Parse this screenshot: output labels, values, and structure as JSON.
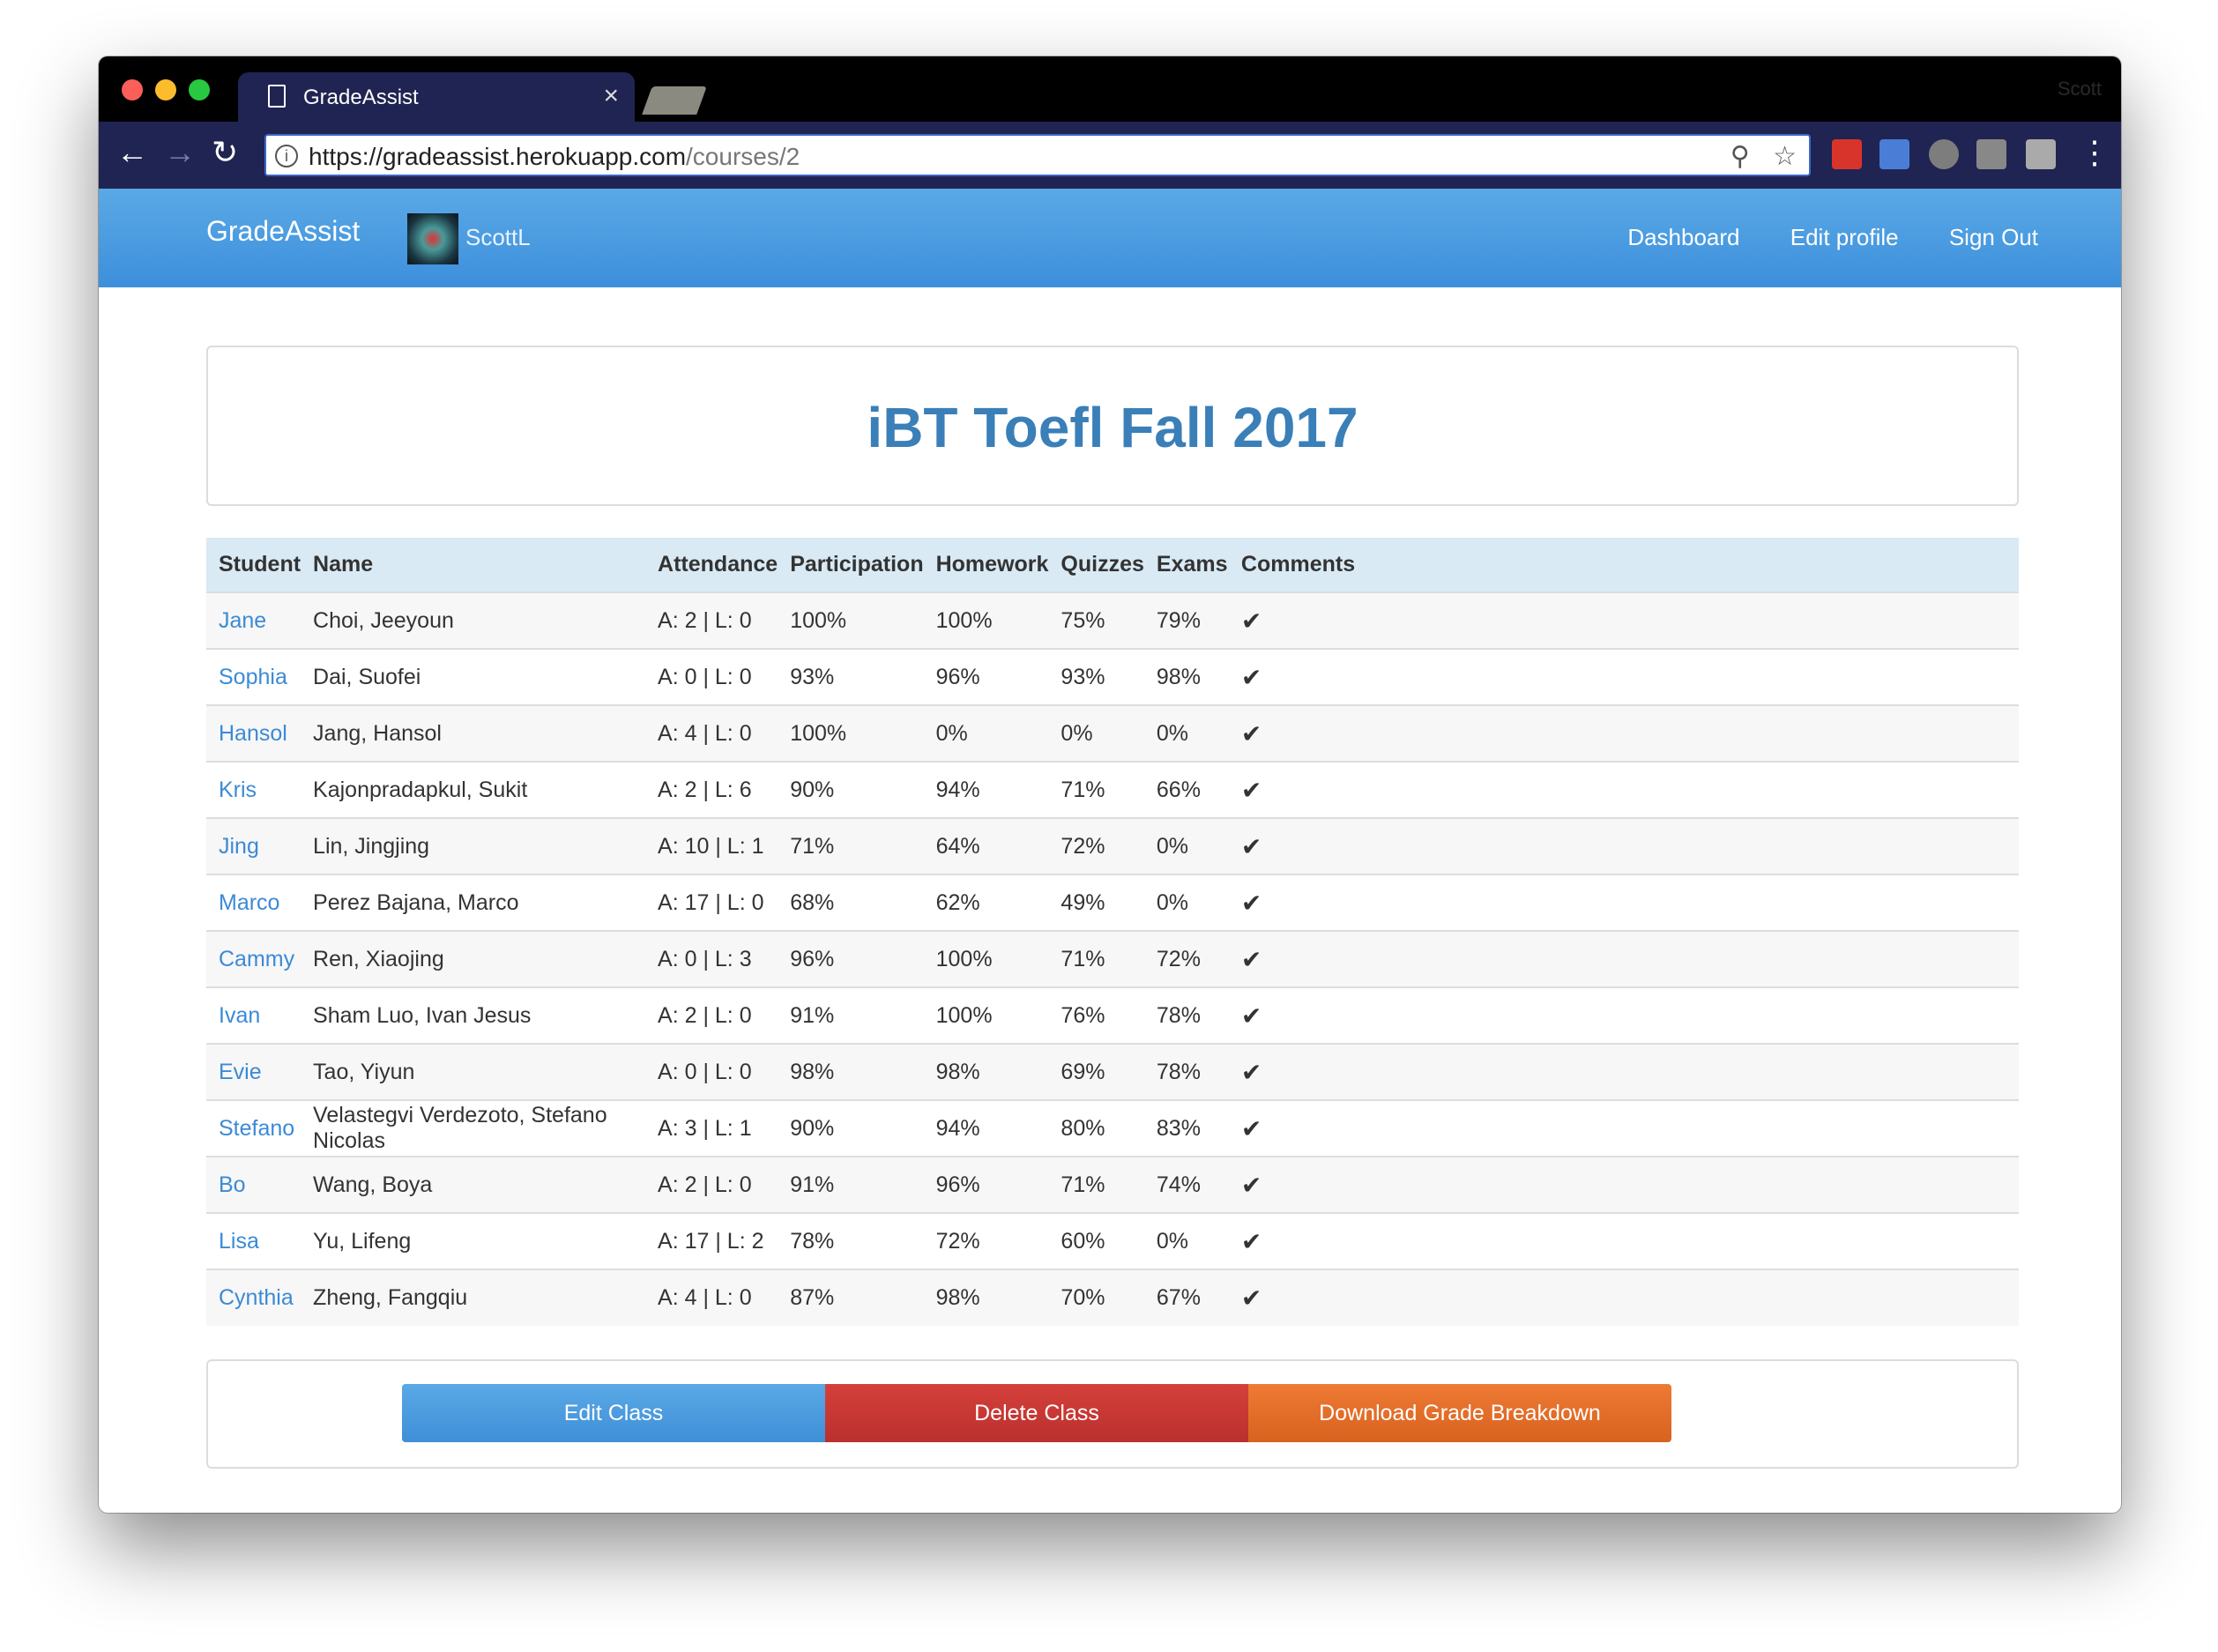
{
  "browser": {
    "tab_title": "GradeAssist",
    "tab_close": "×",
    "profile_name": "Scott",
    "url_host": "https://gradeassist.herokuapp.com",
    "url_path": "/courses/2",
    "back_icon": "arrow-left-icon",
    "forward_icon": "arrow-right-icon",
    "reload_icon": "reload-icon"
  },
  "navbar": {
    "brand": "GradeAssist",
    "username": "ScottL",
    "links": {
      "dashboard": "Dashboard",
      "edit_profile": "Edit profile",
      "sign_out": "Sign Out"
    }
  },
  "course": {
    "title": "iBT Toefl Fall 2017"
  },
  "table": {
    "headers": [
      "Student",
      "Name",
      "Attendance",
      "Participation",
      "Homework",
      "Quizzes",
      "Exams",
      "Comments"
    ],
    "rows": [
      {
        "student": "Jane",
        "name": "Choi, Jeeyoun",
        "attendance": "A: 2 | L: 0",
        "participation": "100%",
        "homework": "100%",
        "quizzes": "75%",
        "exams": "79%"
      },
      {
        "student": "Sophia",
        "name": "Dai, Suofei",
        "attendance": "A: 0 | L: 0",
        "participation": "93%",
        "homework": "96%",
        "quizzes": "93%",
        "exams": "98%"
      },
      {
        "student": "Hansol",
        "name": "Jang, Hansol",
        "attendance": "A: 4 | L: 0",
        "participation": "100%",
        "homework": "0%",
        "quizzes": "0%",
        "exams": "0%"
      },
      {
        "student": "Kris",
        "name": "Kajonpradapkul, Sukit",
        "attendance": "A: 2 | L: 6",
        "participation": "90%",
        "homework": "94%",
        "quizzes": "71%",
        "exams": "66%"
      },
      {
        "student": "Jing",
        "name": "Lin, Jingjing",
        "attendance": "A: 10 | L: 1",
        "participation": "71%",
        "homework": "64%",
        "quizzes": "72%",
        "exams": "0%"
      },
      {
        "student": "Marco",
        "name": "Perez Bajana, Marco",
        "attendance": "A: 17 | L: 0",
        "participation": "68%",
        "homework": "62%",
        "quizzes": "49%",
        "exams": "0%"
      },
      {
        "student": "Cammy",
        "name": "Ren, Xiaojing",
        "attendance": "A: 0 | L: 3",
        "participation": "96%",
        "homework": "100%",
        "quizzes": "71%",
        "exams": "72%"
      },
      {
        "student": "Ivan",
        "name": "Sham Luo, Ivan Jesus",
        "attendance": "A: 2 | L: 0",
        "participation": "91%",
        "homework": "100%",
        "quizzes": "76%",
        "exams": "78%"
      },
      {
        "student": "Evie",
        "name": "Tao, Yiyun",
        "attendance": "A: 0 | L: 0",
        "participation": "98%",
        "homework": "98%",
        "quizzes": "69%",
        "exams": "78%"
      },
      {
        "student": "Stefano",
        "name": "Velastegvi Verdezoto, Stefano Nicolas",
        "attendance": "A: 3 | L: 1",
        "participation": "90%",
        "homework": "94%",
        "quizzes": "80%",
        "exams": "83%"
      },
      {
        "student": "Bo",
        "name": "Wang, Boya",
        "attendance": "A: 2 | L: 0",
        "participation": "91%",
        "homework": "96%",
        "quizzes": "71%",
        "exams": "74%"
      },
      {
        "student": "Lisa",
        "name": "Yu, Lifeng",
        "attendance": "A: 17 | L: 2",
        "participation": "78%",
        "homework": "72%",
        "quizzes": "60%",
        "exams": "0%"
      },
      {
        "student": "Cynthia",
        "name": "Zheng, Fangqiu",
        "attendance": "A: 4 | L: 0",
        "participation": "87%",
        "homework": "98%",
        "quizzes": "70%",
        "exams": "67%"
      }
    ],
    "comment_icon": "checkmark-icon"
  },
  "actions": {
    "edit": "Edit Class",
    "delete": "Delete Class",
    "download": "Download Grade Breakdown"
  },
  "colors": {
    "accent": "#3d8fdc",
    "link": "#3b8ad6",
    "title": "#3a7fb8",
    "danger": "#c9352f",
    "warning": "#e06c27"
  }
}
